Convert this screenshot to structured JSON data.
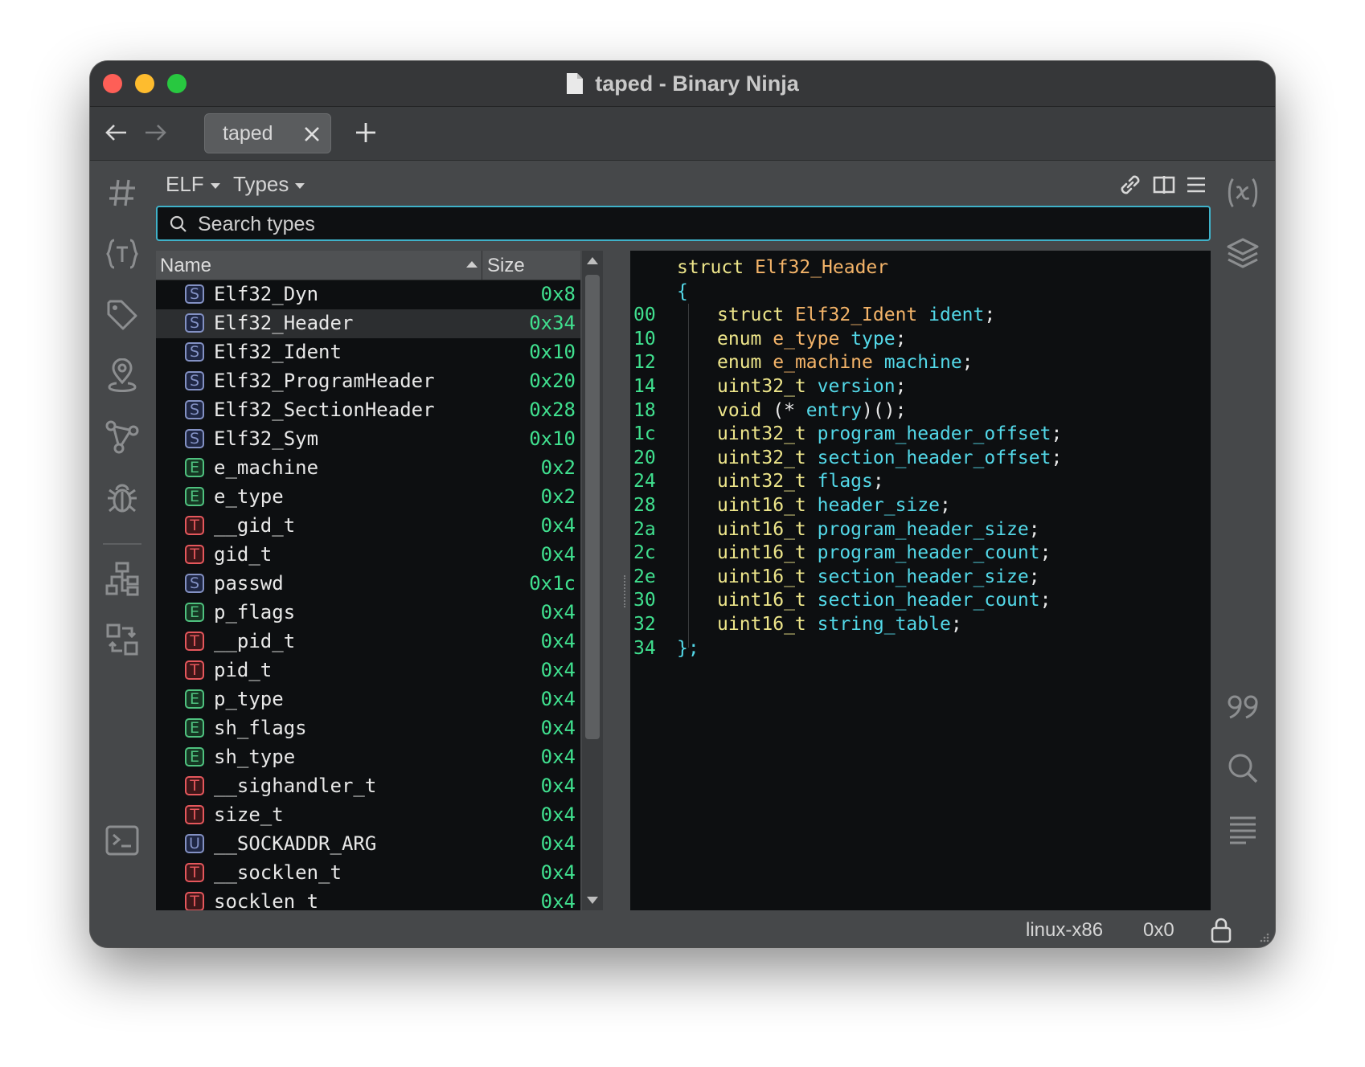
{
  "window": {
    "title": "taped - Binary Ninja"
  },
  "tabs": [
    {
      "label": "taped"
    }
  ],
  "toolbar": {
    "view_dropdown": "ELF",
    "types_dropdown": "Types"
  },
  "search": {
    "placeholder": "Search types",
    "value": ""
  },
  "type_list": {
    "columns": {
      "name": "Name",
      "size": "Size"
    },
    "rows": [
      {
        "kind": "S",
        "name": "Elf32_Dyn",
        "size": "0x8"
      },
      {
        "kind": "S",
        "name": "Elf32_Header",
        "size": "0x34",
        "selected": true
      },
      {
        "kind": "S",
        "name": "Elf32_Ident",
        "size": "0x10"
      },
      {
        "kind": "S",
        "name": "Elf32_ProgramHeader",
        "size": "0x20"
      },
      {
        "kind": "S",
        "name": "Elf32_SectionHeader",
        "size": "0x28"
      },
      {
        "kind": "S",
        "name": "Elf32_Sym",
        "size": "0x10"
      },
      {
        "kind": "E",
        "name": "e_machine",
        "size": "0x2"
      },
      {
        "kind": "E",
        "name": "e_type",
        "size": "0x2"
      },
      {
        "kind": "T",
        "name": "__gid_t",
        "size": "0x4"
      },
      {
        "kind": "T",
        "name": "gid_t",
        "size": "0x4"
      },
      {
        "kind": "S",
        "name": "passwd",
        "size": "0x1c"
      },
      {
        "kind": "E",
        "name": "p_flags",
        "size": "0x4"
      },
      {
        "kind": "T",
        "name": "__pid_t",
        "size": "0x4"
      },
      {
        "kind": "T",
        "name": "pid_t",
        "size": "0x4"
      },
      {
        "kind": "E",
        "name": "p_type",
        "size": "0x4"
      },
      {
        "kind": "E",
        "name": "sh_flags",
        "size": "0x4"
      },
      {
        "kind": "E",
        "name": "sh_type",
        "size": "0x4"
      },
      {
        "kind": "T",
        "name": "__sighandler_t",
        "size": "0x4"
      },
      {
        "kind": "T",
        "name": "size_t",
        "size": "0x4"
      },
      {
        "kind": "U",
        "name": "__SOCKADDR_ARG",
        "size": "0x4"
      },
      {
        "kind": "T",
        "name": "__socklen_t",
        "size": "0x4"
      },
      {
        "kind": "T",
        "name": "socklen_t",
        "size": "0x4"
      }
    ]
  },
  "code": {
    "header": {
      "keyword": "struct",
      "name": "Elf32_Header"
    },
    "open_brace": "{",
    "close_brace": "};",
    "end_offset": "34",
    "fields": [
      {
        "offset": "00",
        "prefix": "struct",
        "type": "Elf32_Ident",
        "name": "ident",
        "suffix": ";"
      },
      {
        "offset": "10",
        "prefix": "enum",
        "type": "e_type",
        "name": "type",
        "suffix": ";"
      },
      {
        "offset": "12",
        "prefix": "enum",
        "type": "e_machine",
        "name": "machine",
        "suffix": ";"
      },
      {
        "offset": "14",
        "prefix": "",
        "type": "uint32_t",
        "name": "version",
        "suffix": ";"
      },
      {
        "offset": "18",
        "prefix": "",
        "type": "void",
        "pre_name": "(* ",
        "name": "entry",
        "suffix": ")();"
      },
      {
        "offset": "1c",
        "prefix": "",
        "type": "uint32_t",
        "name": "program_header_offset",
        "suffix": ";"
      },
      {
        "offset": "20",
        "prefix": "",
        "type": "uint32_t",
        "name": "section_header_offset",
        "suffix": ";"
      },
      {
        "offset": "24",
        "prefix": "",
        "type": "uint32_t",
        "name": "flags",
        "suffix": ";"
      },
      {
        "offset": "28",
        "prefix": "",
        "type": "uint16_t",
        "name": "header_size",
        "suffix": ";"
      },
      {
        "offset": "2a",
        "prefix": "",
        "type": "uint16_t",
        "name": "program_header_size",
        "suffix": ";"
      },
      {
        "offset": "2c",
        "prefix": "",
        "type": "uint16_t",
        "name": "program_header_count",
        "suffix": ";"
      },
      {
        "offset": "2e",
        "prefix": "",
        "type": "uint16_t",
        "name": "section_header_size",
        "suffix": ";"
      },
      {
        "offset": "30",
        "prefix": "",
        "type": "uint16_t",
        "name": "section_header_count",
        "suffix": ";"
      },
      {
        "offset": "32",
        "prefix": "",
        "type": "uint16_t",
        "name": "string_table",
        "suffix": ";"
      }
    ]
  },
  "status": {
    "platform": "linux-x86",
    "address": "0x0"
  },
  "colors": {
    "accent": "#3fb2c9",
    "size_green": "#40e08f",
    "keyword": "#ede58a",
    "type_name": "#f4b469",
    "field_name": "#53d8e8",
    "struct_badge": "#8391c4",
    "enum_badge": "#4fc27f",
    "typedef_badge": "#e5575c"
  },
  "icons": {
    "left_sidebar": [
      "hash-icon",
      "type-braces-icon",
      "tag-icon",
      "location-pin-icon",
      "graph-branch-icon",
      "bug-icon",
      "hierarchy-icon",
      "cross-reference-icon",
      "terminal-icon"
    ],
    "right_sidebar": [
      "variable-icon",
      "layers-icon",
      "quote-icon",
      "search-icon",
      "text-lines-icon"
    ],
    "toolbar": [
      "link-icon",
      "split-view-icon",
      "menu-icon"
    ]
  }
}
